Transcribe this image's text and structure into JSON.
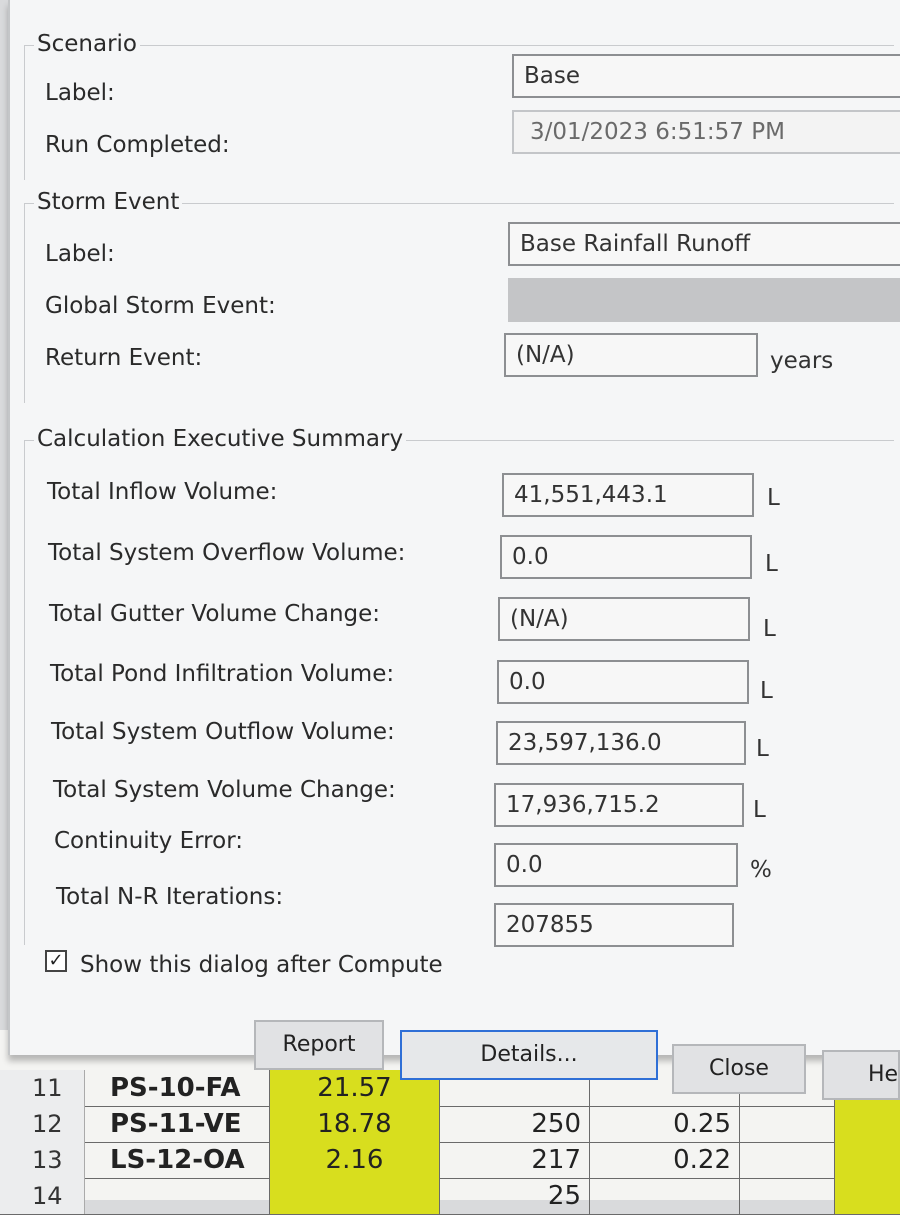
{
  "scenario": {
    "title": "Scenario",
    "label_caption": "Label:",
    "label_value": "Base",
    "run_caption": "Run Completed:",
    "run_value": "3/01/2023   6:51:57 PM"
  },
  "storm": {
    "title": "Storm Event",
    "label_caption": "Label:",
    "label_value": "Base Rainfall Runoff",
    "global_caption": "Global Storm Event:",
    "global_value": "",
    "return_caption": "Return Event:",
    "return_value": "(N/A)",
    "return_unit": "years"
  },
  "summary": {
    "title": "Calculation Executive Summary",
    "rows": [
      {
        "label": "Total Inflow Volume:",
        "value": "41,551,443.1",
        "unit": "L"
      },
      {
        "label": "Total System Overflow Volume:",
        "value": "0.0",
        "unit": "L"
      },
      {
        "label": "Total Gutter Volume Change:",
        "value": "(N/A)",
        "unit": "L"
      },
      {
        "label": "Total Pond Infiltration Volume:",
        "value": "0.0",
        "unit": "L"
      },
      {
        "label": "Total System Outflow Volume:",
        "value": "23,597,136.0",
        "unit": "L"
      },
      {
        "label": "Total System Volume Change:",
        "value": "17,936,715.2",
        "unit": "L"
      },
      {
        "label": "Continuity Error:",
        "value": "0.0",
        "unit": "%"
      },
      {
        "label": "Total N-R Iterations:",
        "value": "207855",
        "unit": ""
      }
    ]
  },
  "show_dialog": {
    "checked": true,
    "label": "Show this dialog after Compute"
  },
  "buttons": {
    "report": "Report",
    "details": "Details...",
    "close": "Close",
    "help": "He"
  },
  "sheet": {
    "rows": [
      {
        "num": "11",
        "id": "PS-10-FA",
        "value": "21.57",
        "count": "",
        "ratio": ""
      },
      {
        "num": "12",
        "id": "PS-11-VE",
        "value": "18.78",
        "count": "250",
        "ratio": "0.25"
      },
      {
        "num": "13",
        "id": "LS-12-OA",
        "value": "2.16",
        "count": "217",
        "ratio": "0.22"
      },
      {
        "num": "14",
        "id": "",
        "value": "",
        "count": "25",
        "ratio": ""
      }
    ]
  }
}
